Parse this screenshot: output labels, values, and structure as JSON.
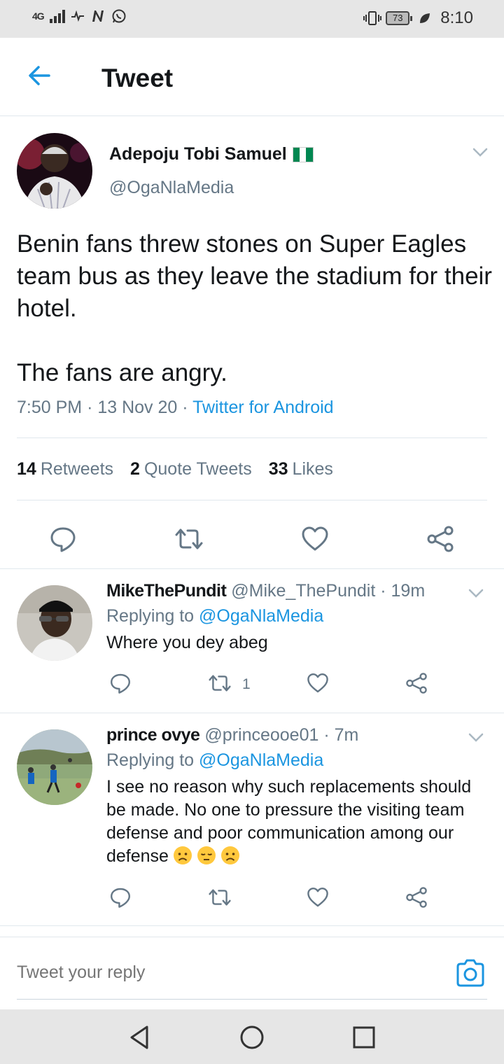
{
  "status_bar": {
    "network": "4G",
    "battery": "73",
    "time": "8:10"
  },
  "header": {
    "title": "Tweet"
  },
  "tweet": {
    "author_name": "Adepoju Tobi Samuel",
    "author_handle": "@OgaNlaMedia",
    "text": "Benin fans threw stones on Super Eagles team bus as they leave the stadium for their hotel.\n\nThe fans are angry.",
    "time": "7:50 PM",
    "date": "13 Nov 20",
    "source": "Twitter for Android",
    "retweets_count": "14",
    "retweets_label": "Retweets",
    "quotes_count": "2",
    "quotes_label": "Quote Tweets",
    "likes_count": "33",
    "likes_label": "Likes"
  },
  "replies": [
    {
      "name": "MikeThePundit",
      "handle": "@Mike_ThePundit",
      "age": "19m",
      "replying_label": "Replying to",
      "replying_to": "@OgaNlaMedia",
      "text": "Where you dey abeg",
      "retweet_count": "1"
    },
    {
      "name": "prince ovye",
      "handle": "@princeooe01",
      "age": "7m",
      "replying_label": "Replying to",
      "replying_to": "@OgaNlaMedia",
      "text": "I see no reason why such replacements should be made. No one to pressure the visiting team defense and poor communication among our defense"
    }
  ],
  "composer": {
    "placeholder": "Tweet your reply"
  },
  "colors": {
    "accent": "#1b95e0",
    "text": "#14171a",
    "secondary": "#657786"
  },
  "icons": [
    "back-arrow-icon",
    "chevron-down-icon",
    "reply-icon",
    "retweet-icon",
    "like-icon",
    "share-icon",
    "camera-icon",
    "nav-back-icon",
    "nav-home-icon",
    "nav-recents-icon"
  ]
}
